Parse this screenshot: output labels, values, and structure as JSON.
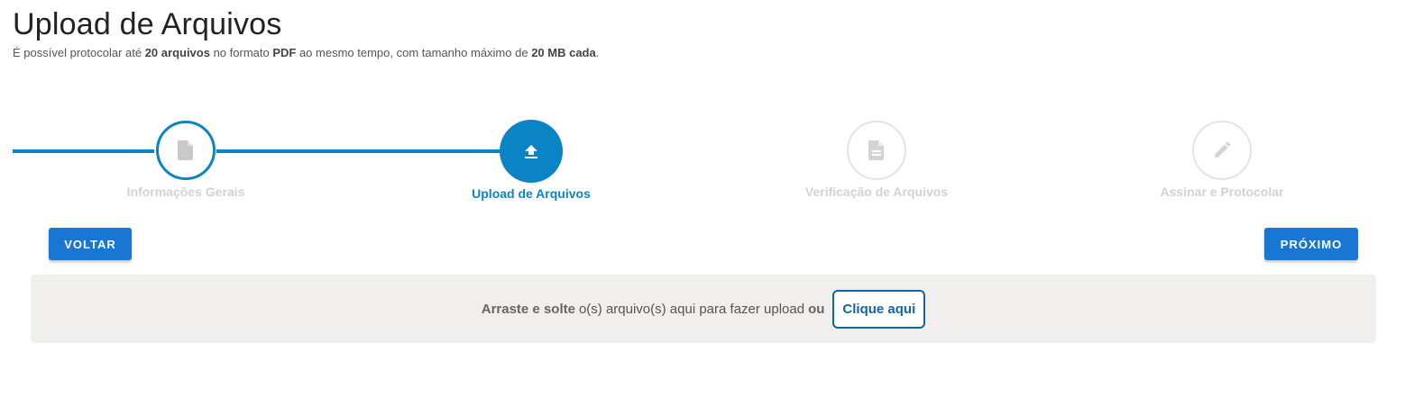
{
  "header": {
    "title": "Upload de Arquivos",
    "subtitle": {
      "p1": "É possível protocolar até ",
      "b1": "20 arquivos",
      "p2": " no formato ",
      "b2": "PDF",
      "p3": " ao mesmo tempo, com tamanho máximo de ",
      "b3": "20 MB cada",
      "p4": "."
    }
  },
  "stepper": {
    "steps": [
      {
        "label": "Informações Gerais",
        "icon": "document-icon",
        "state": "done"
      },
      {
        "label": "Upload de Arquivos",
        "icon": "upload-icon",
        "state": "active"
      },
      {
        "label": "Verificação de Arquivos",
        "icon": "document-lines-icon",
        "state": "pending"
      },
      {
        "label": "Assinar e Protocolar",
        "icon": "pencil-icon",
        "state": "pending"
      }
    ]
  },
  "buttons": {
    "back": "VOLTAR",
    "next": "PRÓXIMO"
  },
  "dropzone": {
    "bold_prefix": "Arraste e solte",
    "text": "o(s) arquivo(s) aqui para fazer upload",
    "or": "ou",
    "button": "Clique aqui"
  },
  "colors": {
    "accent": "#0b84c6",
    "button": "#1976d2",
    "pending": "#d2d2d2",
    "dropzone_bg": "#f0efee"
  }
}
